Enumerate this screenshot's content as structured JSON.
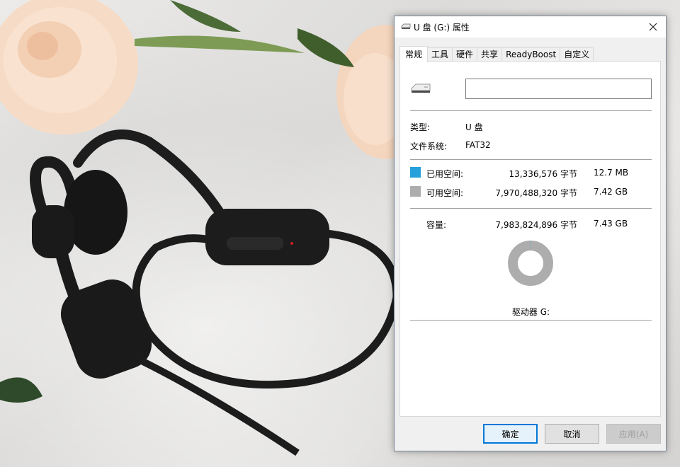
{
  "window": {
    "title": "U 盘 (G:) 属性"
  },
  "tabs": [
    {
      "label": "常规",
      "active": true
    },
    {
      "label": "工具",
      "active": false
    },
    {
      "label": "硬件",
      "active": false
    },
    {
      "label": "共享",
      "active": false
    },
    {
      "label": "ReadyBoost",
      "active": false
    },
    {
      "label": "自定义",
      "active": false
    }
  ],
  "general": {
    "name_value": "",
    "type_label": "类型:",
    "type_value": "U 盘",
    "fs_label": "文件系统:",
    "fs_value": "FAT32",
    "used_label": "已用空间:",
    "used_bytes": "13,336,576 字节",
    "used_size": "12.7 MB",
    "free_label": "可用空间:",
    "free_bytes": "7,970,488,320 字节",
    "free_size": "7.42 GB",
    "capacity_label": "容量:",
    "capacity_bytes": "7,983,824,896 字节",
    "capacity_size": "7.43 GB",
    "drive_label": "驱动器 G:",
    "used_fraction": 0.00167
  },
  "buttons": {
    "ok": "确定",
    "cancel": "取消",
    "apply": "应用(A)"
  },
  "colors": {
    "used": "#26a0da",
    "free": "#adadad",
    "accent": "#0078d7"
  },
  "icons": {
    "title": "usb-drive-icon",
    "close": "close-icon",
    "drive": "usb-drive-icon"
  }
}
